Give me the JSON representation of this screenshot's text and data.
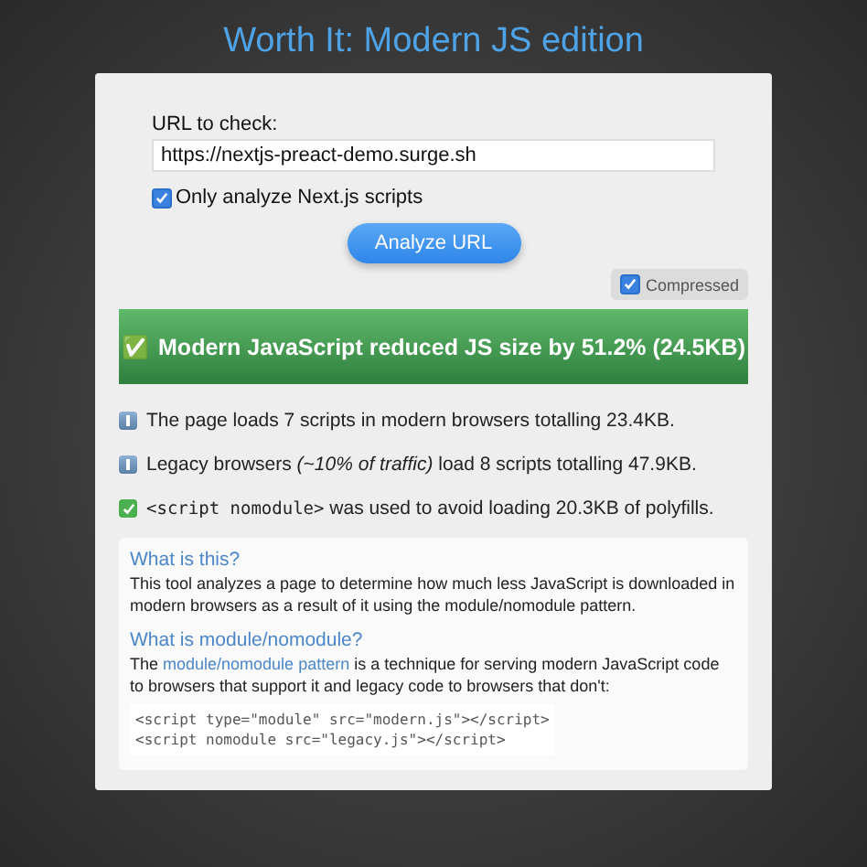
{
  "title": "Worth It: Modern JS edition",
  "form": {
    "label": "URL to check:",
    "url": "https://nextjs-preact-demo.surge.sh",
    "only_next": {
      "label": "Only analyze Next.js scripts",
      "checked": true
    },
    "button": "Analyze URL",
    "compressed": {
      "label": "Compressed",
      "checked": true
    }
  },
  "banner": {
    "icon": "✅",
    "text": "Modern JavaScript reduced JS size by 51.2% (24.5KB)"
  },
  "findings": [
    {
      "kind": "info",
      "text": "The page loads 7 scripts in modern browsers totalling 23.4KB."
    },
    {
      "kind": "info",
      "text": "Legacy browsers *(~10% of traffic)* load 8 scripts totalling 47.9KB."
    },
    {
      "kind": "check",
      "code": "<script nomodule>",
      "text": " was used to avoid loading 20.3KB of polyfills."
    }
  ],
  "about": {
    "heading1": "What is this?",
    "para1": "This tool analyzes a page to determine how much less JavaScript is downloaded in modern browsers as a result of it using the module/nomodule pattern.",
    "heading2": "What is module/nomodule?",
    "para2_before": "The ",
    "para2_link": "module/nomodule pattern",
    "para2_after": " is a technique for serving modern JavaScript code to browsers that support it and legacy code to browsers that don't:",
    "code": [
      "<script type=\"module\" src=\"modern.js\"></script>",
      "<script nomodule src=\"legacy.js\"></script>"
    ]
  }
}
